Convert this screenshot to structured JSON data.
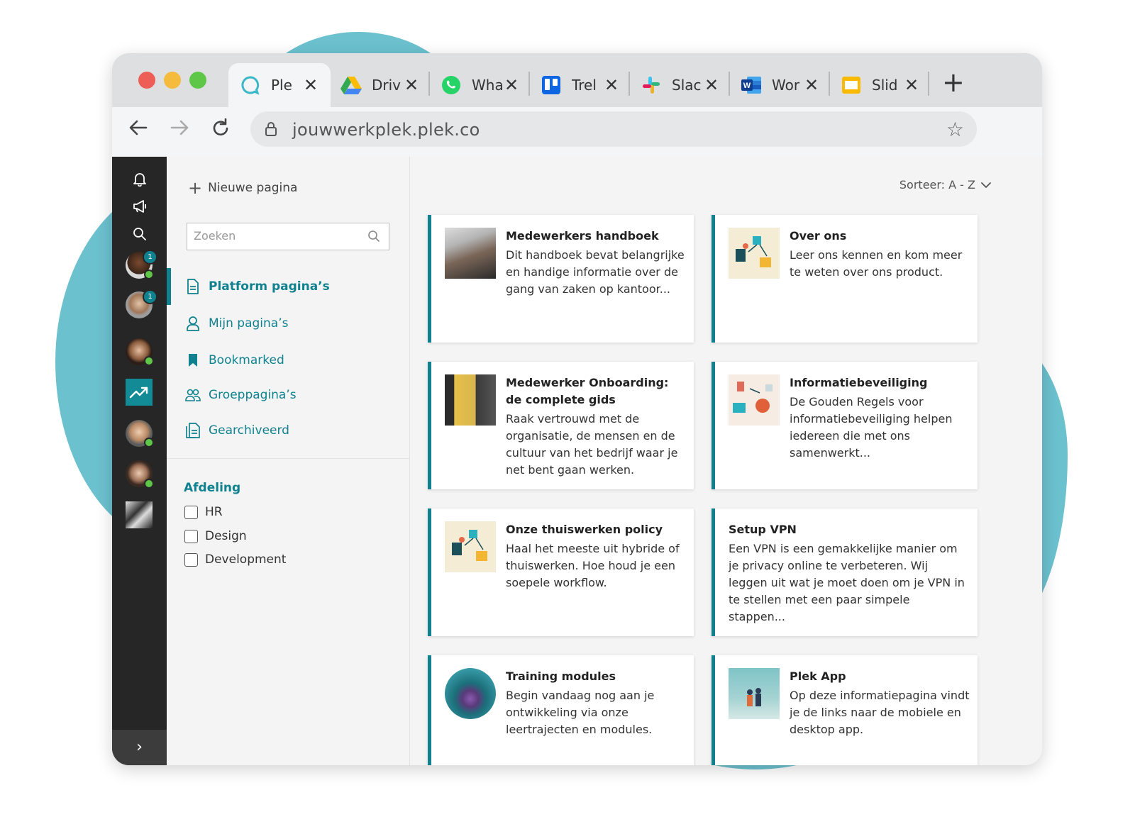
{
  "browser": {
    "tabs": [
      {
        "label": "Ple",
        "icon": "plek-icon"
      },
      {
        "label": "Driv",
        "icon": "google-drive-icon"
      },
      {
        "label": "Wha",
        "icon": "whatsapp-icon"
      },
      {
        "label": "Trel",
        "icon": "trello-icon"
      },
      {
        "label": "Slac",
        "icon": "slack-icon"
      },
      {
        "label": "Wor",
        "icon": "word-icon"
      },
      {
        "label": "Slid",
        "icon": "slides-icon"
      }
    ],
    "close_glyph": "✕",
    "new_tab_glyph": "+",
    "url": "jouwwerkplek.plek.co"
  },
  "rail": {
    "badges": [
      "1",
      "1"
    ],
    "expand_glyph": "›"
  },
  "sidebar": {
    "new_page": "Nieuwe pagina",
    "search_placeholder": "Zoeken",
    "nav": [
      {
        "label": "Platform pagina’s",
        "icon": "document-icon"
      },
      {
        "label": "Mijn pagina’s",
        "icon": "user-icon"
      },
      {
        "label": "Bookmarked",
        "icon": "bookmark-icon"
      },
      {
        "label": "Groeppagina’s",
        "icon": "group-icon"
      },
      {
        "label": "Gearchiveerd",
        "icon": "archive-icon"
      }
    ],
    "filter": {
      "title": "Afdeling",
      "options": [
        "HR",
        "Design",
        "Development"
      ]
    }
  },
  "main": {
    "sort_label": "Sorteer: A - Z",
    "cards": [
      {
        "title": "Medewerkers handboek",
        "desc": "Dit handboek bevat belangrijke en handige informatie over de gang van zaken op kantoor..."
      },
      {
        "title": "Over ons",
        "desc": "Leer ons kennen en kom meer te weten over ons product."
      },
      {
        "title": "Medewerker Onboarding: de complete gids",
        "desc": "Raak vertrouwd met de organisatie, de mensen en de cultuur van het bedrijf waar je net bent gaan werken."
      },
      {
        "title": "Informatiebeveiliging",
        "desc": "De Gouden Regels voor informatiebeveiliging helpen iedereen die met ons samenwerkt..."
      },
      {
        "title": "Onze thuiswerken policy",
        "desc": "Haal het meeste uit hybride of thuiswerken. Hoe houd je een soepele workflow."
      },
      {
        "title": "Setup VPN",
        "desc": "Een VPN is een gemakkelijke manier om je privacy online te verbeteren. Wij leggen uit wat je moet doen om je VPN in te stellen met een paar simpele stappen..."
      },
      {
        "title": "Training modules",
        "desc": "Begin vandaag nog aan je ontwikkeling via onze leertrajecten en modules."
      },
      {
        "title": "Plek App",
        "desc": "Op deze informatiepagina vindt je de links naar de mobiele en desktop app."
      }
    ]
  },
  "colors": {
    "accent": "#10828f",
    "blob": "#6cc1cf",
    "rail": "#262626"
  }
}
